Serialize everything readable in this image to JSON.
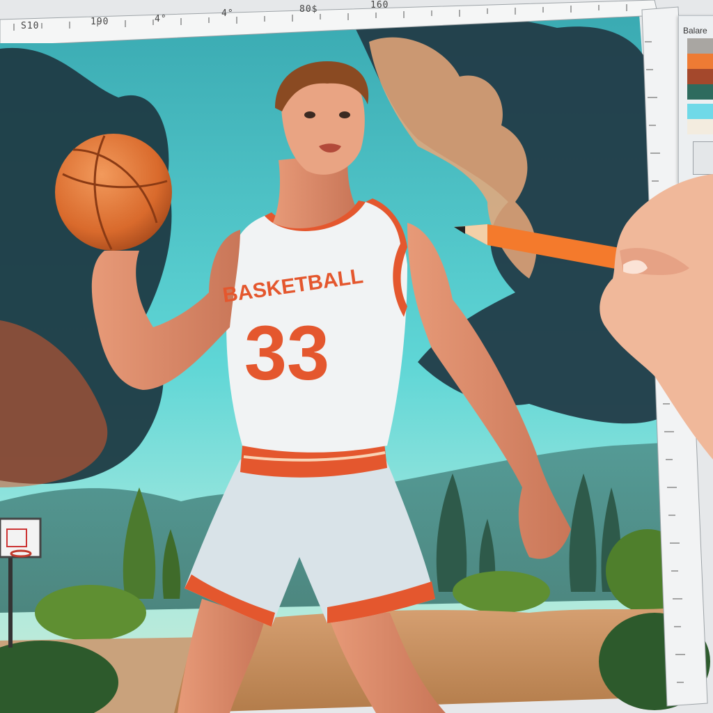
{
  "ruler": {
    "top_labels": [
      "S10",
      "190",
      "4°",
      "4°",
      "80$",
      "160"
    ]
  },
  "palette": {
    "title": "Balare",
    "swatches": [
      {
        "name": "swatch-gray",
        "color": "#a9a6a2"
      },
      {
        "name": "swatch-orange",
        "color": "#ee7b34"
      },
      {
        "name": "swatch-rust",
        "color": "#a4482c"
      },
      {
        "name": "swatch-teal",
        "color": "#2e6b5e"
      },
      {
        "name": "swatch-cyan",
        "color": "#6fd9e8"
      },
      {
        "name": "swatch-cream",
        "color": "#f3ecdf"
      }
    ]
  },
  "artwork": {
    "jersey_text": "BASKETBALL",
    "jersey_number": "33"
  },
  "colors": {
    "sky": "#4cc9cf",
    "jersey_accent": "#e4572e",
    "pencil": "#f47a2c"
  }
}
